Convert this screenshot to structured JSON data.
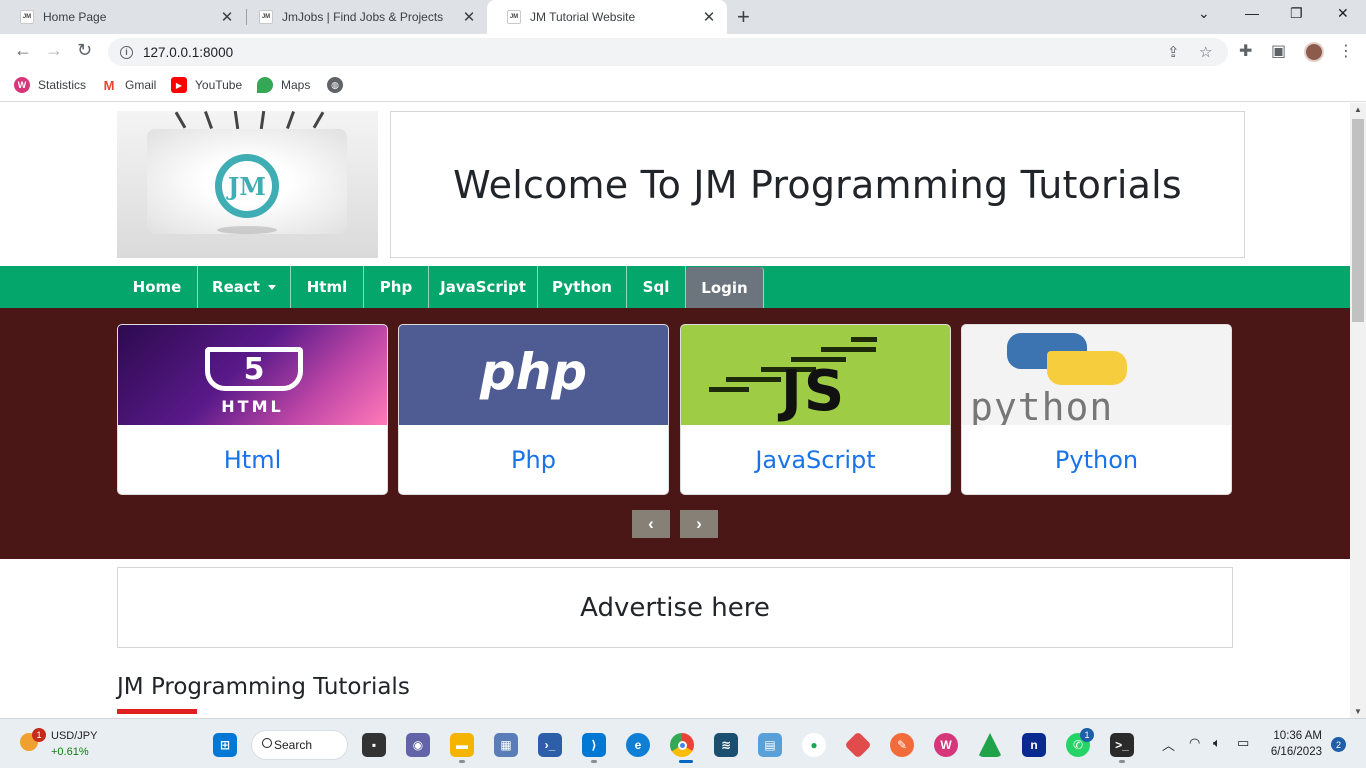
{
  "browser": {
    "tabs": [
      {
        "title": "Home Page",
        "active": false
      },
      {
        "title": "JmJobs | Find Jobs & Projects",
        "active": false
      },
      {
        "title": "JM Tutorial Website",
        "active": true
      }
    ],
    "url": "127.0.0.1:8000",
    "bookmarks": [
      {
        "label": "Statistics",
        "icon": "statistics-icon",
        "color": "#d6367a"
      },
      {
        "label": "Gmail",
        "icon": "gmail-icon",
        "color": "#ea4335"
      },
      {
        "label": "YouTube",
        "icon": "youtube-icon",
        "color": "#ff0000"
      },
      {
        "label": "Maps",
        "icon": "maps-icon",
        "color": "#34a853"
      }
    ]
  },
  "header": {
    "welcome": "Welcome To JM Programming Tutorials",
    "logo_text": "JM"
  },
  "nav": {
    "items": [
      "Home",
      "React",
      "Html",
      "Php",
      "JavaScript",
      "Python",
      "Sql"
    ],
    "login": "Login",
    "color": "#05a66b"
  },
  "carousel": {
    "background": "#4a1616",
    "cards": [
      {
        "title": "Html",
        "image_text": "HTML",
        "badge": "5"
      },
      {
        "title": "Php",
        "image_text": "php"
      },
      {
        "title": "JavaScript",
        "image_text": "JS"
      },
      {
        "title": "Python",
        "image_text": "python"
      }
    ],
    "prev": "‹",
    "next": "›"
  },
  "advert": "Advertise here",
  "section_title": "JM Programming Tutorials",
  "taskbar": {
    "ticker": "USD/JPY",
    "change": "+0.61%",
    "weather_badge": "1",
    "search": "Search",
    "whatsapp_badge": "1",
    "time": "10:36 AM",
    "date": "6/16/2023",
    "notifications": "2"
  }
}
